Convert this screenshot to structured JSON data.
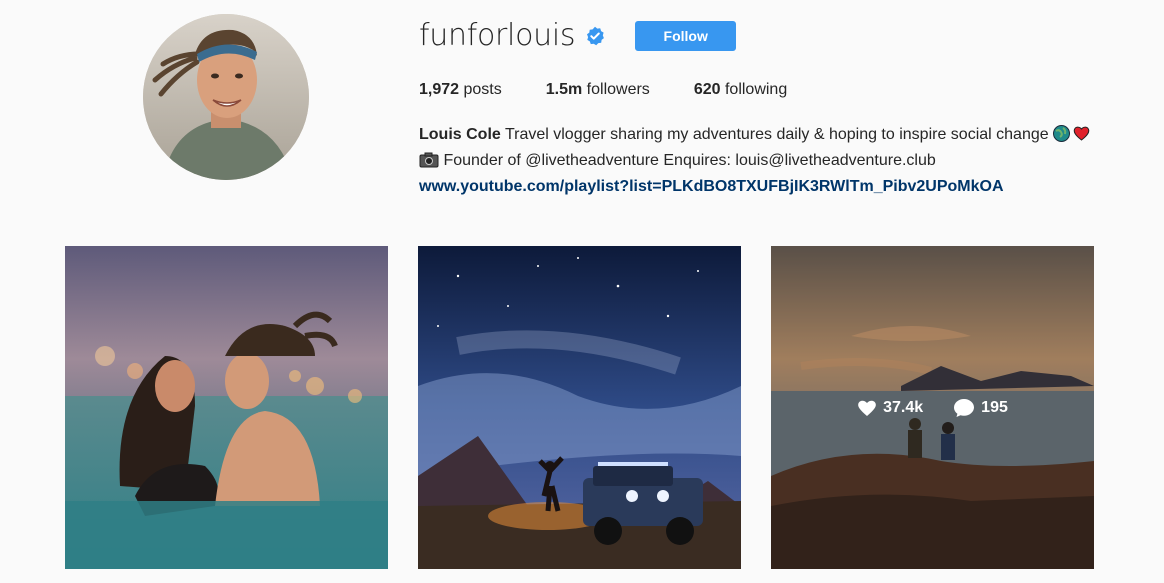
{
  "profile": {
    "username": "funforlouis",
    "verified": true,
    "follow_label": "Follow",
    "stats": {
      "posts_count": "1,972",
      "posts_label": "posts",
      "followers_count": "1.5m",
      "followers_label": "followers",
      "following_count": "620",
      "following_label": "following"
    },
    "bio": {
      "name": "Louis Cole",
      "text_1": "Travel vlogger sharing my adventures daily & hoping to inspire social change",
      "emojis": [
        "globe-emoji",
        "heart-emoji",
        "camera-emoji"
      ],
      "text_2": "Founder of @livetheadventure Enquires: louis@livetheadventure.club",
      "link": "www.youtube.com/playlist?list=PLKdBO8TXUFBjIK3RWlTm_Pibv2UPoMkOA"
    }
  },
  "posts": [
    {
      "image": "couple-in-pool-photo"
    },
    {
      "image": "night-sky-jeep-photo"
    },
    {
      "image": "sunset-cliff-photo",
      "likes": "37.4k",
      "comments": "195"
    }
  ],
  "colors": {
    "accent": "#3897f0",
    "link": "#003569",
    "background": "#fafafa"
  }
}
